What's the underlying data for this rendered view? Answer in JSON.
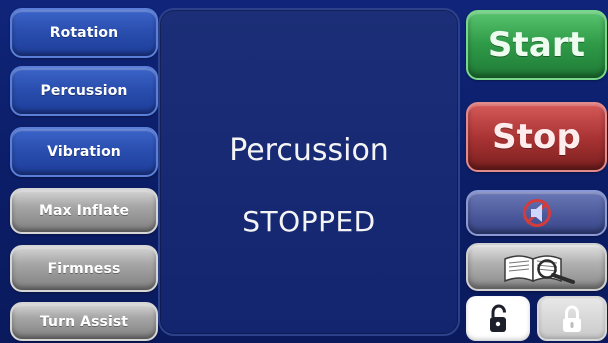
{
  "left_controls": {
    "rotation_label": "Rotation",
    "percussion_label": "Percussion",
    "vibration_label": "Vibration",
    "max_inflate_label": "Max Inflate",
    "firmness_label": "Firmness",
    "turn_assist_label": "Turn Assist"
  },
  "status": {
    "mode": "Percussion",
    "state": "STOPPED"
  },
  "right_controls": {
    "start_label": "Start",
    "stop_label": "Stop",
    "mute_icon": "muted-speaker-icon",
    "manual_icon": "manual-search-icon",
    "unlock_icon": "unlock-icon",
    "lock_icon": "lock-icon"
  },
  "colors": {
    "background": "#0b1e66",
    "blue_button": "#2a4fb0",
    "gray_button": "#a7a7a7",
    "start": "#2f9b48",
    "stop": "#a93333"
  }
}
